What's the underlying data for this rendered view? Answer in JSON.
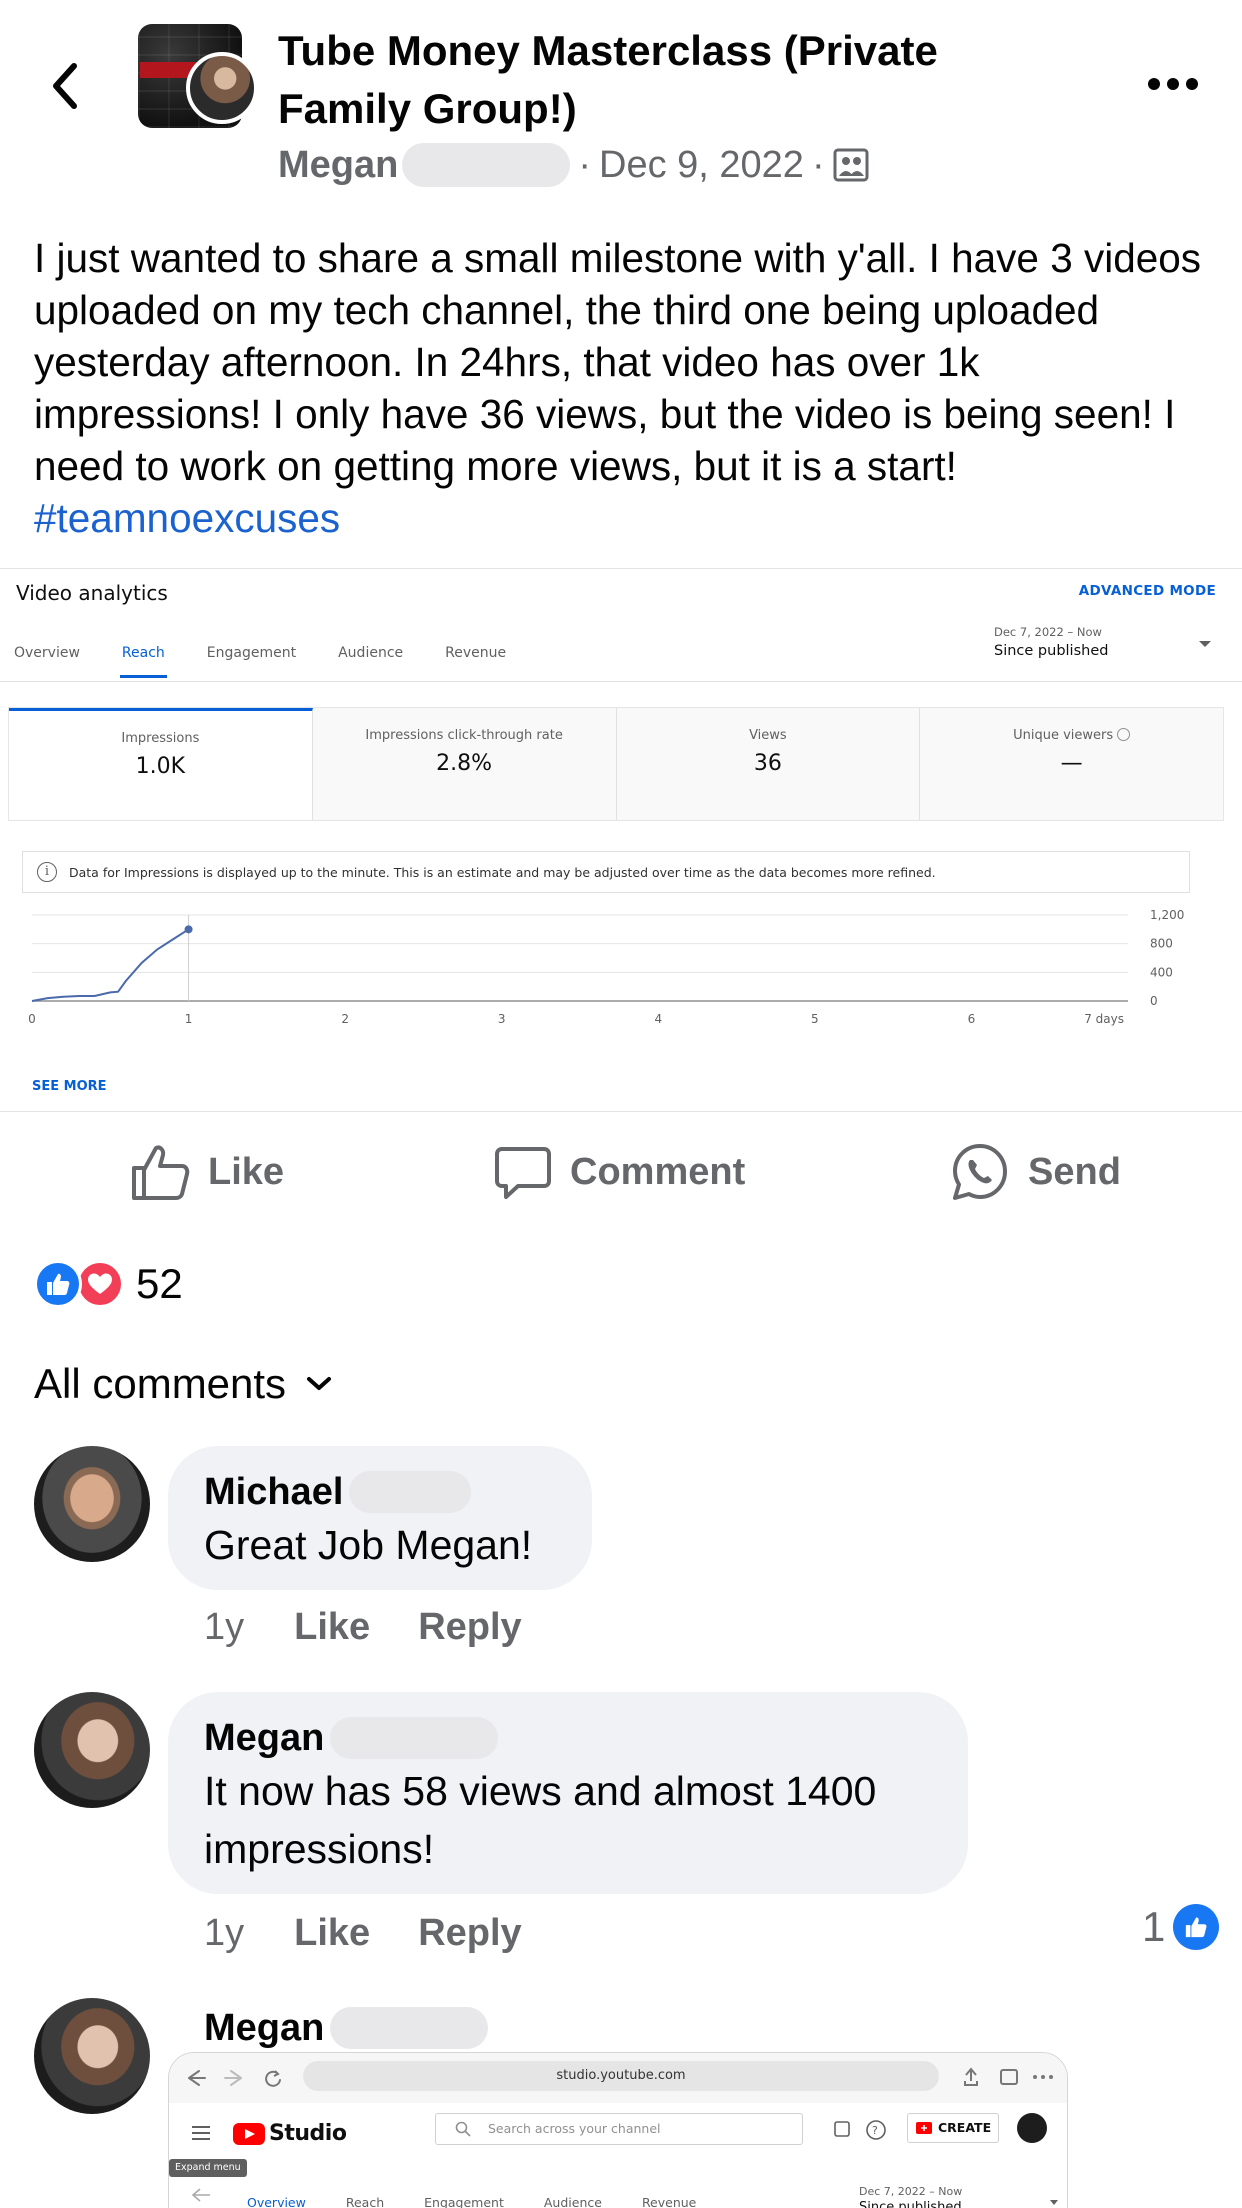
{
  "header": {
    "group_name": "Tube Money Masterclass (Private Family Group!)",
    "author": "Megan",
    "date": "Dec 9, 2022",
    "separator": "·",
    "privacy_icon": "members-group-icon",
    "more_icon": "more-horizontal-icon",
    "back_icon": "chevron-left-icon"
  },
  "post": {
    "text": "I just wanted to share a small milestone with y'all.  I have 3 videos uploaded on my tech channel, the third one being uploaded yesterday afternoon.  In 24hrs, that video has over 1k impressions!  I only have 36 views, but the video is being seen!  I need to work on getting more views, but it is a start! ",
    "hashtag": "#teamnoexcuses"
  },
  "analytics": {
    "title": "Video analytics",
    "advanced_mode": "ADVANCED MODE",
    "tabs": [
      "Overview",
      "Reach",
      "Engagement",
      "Audience",
      "Revenue"
    ],
    "active_tab": "Reach",
    "range_dates": "Dec 7, 2022 – Now",
    "range_label": "Since published",
    "metrics": [
      {
        "label": "Impressions",
        "value": "1.0K"
      },
      {
        "label": "Impressions click-through rate",
        "value": "2.8%"
      },
      {
        "label": "Views",
        "value": "36"
      },
      {
        "label": "Unique viewers",
        "value": "—"
      }
    ],
    "info_text": "Data for Impressions is displayed up to the minute. This is an estimate and may be adjusted over time as the data becomes more refined.",
    "see_more": "SEE MORE",
    "accent_color": "#065fd4"
  },
  "chart_data": {
    "type": "line",
    "x_ticks": [
      "0",
      "1",
      "2",
      "3",
      "4",
      "5",
      "6",
      "7 days"
    ],
    "y_ticks": [
      "1,200",
      "800",
      "400",
      "0"
    ],
    "ylim": [
      0,
      1200
    ],
    "xlim": [
      0,
      7
    ],
    "series": [
      {
        "x": [
          0,
          0.1,
          0.2,
          0.3,
          0.4,
          0.5,
          0.55,
          0.6,
          0.7,
          0.8,
          0.9,
          1.0
        ],
        "y": [
          0,
          40,
          60,
          70,
          70,
          120,
          130,
          280,
          530,
          720,
          860,
          1000
        ]
      }
    ],
    "grid": true,
    "color": "#4a6aab"
  },
  "actions": {
    "like": "Like",
    "comment": "Comment",
    "send": "Send"
  },
  "reactions": {
    "count": "52"
  },
  "comments_header": "All comments",
  "comments": [
    {
      "name": "Michael",
      "text": "Great Job Megan!",
      "time": "1y",
      "like": "Like",
      "reply": "Reply"
    },
    {
      "name": "Megan",
      "text": "It now has 58 views and almost 1400 impressions!",
      "time": "1y",
      "like": "Like",
      "reply": "Reply",
      "like_count": "1"
    },
    {
      "name": "Megan"
    }
  ],
  "studio": {
    "url": "studio.youtube.com",
    "logo": "Studio",
    "search_placeholder": "Search across your channel",
    "create": "CREATE",
    "expand_menu": "Expand menu",
    "tabs": [
      "Overview",
      "Reach",
      "Engagement",
      "Audience",
      "Revenue"
    ],
    "range_dates": "Dec 7, 2022 – Now",
    "range_label": "Since published"
  }
}
